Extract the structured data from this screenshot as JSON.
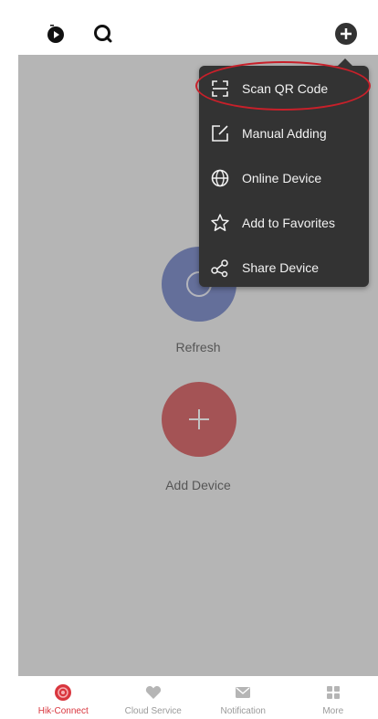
{
  "menu": {
    "items": [
      {
        "label": "Scan QR Code",
        "icon": "scan-qr-icon"
      },
      {
        "label": "Manual Adding",
        "icon": "edit-icon"
      },
      {
        "label": "Online Device",
        "icon": "globe-icon"
      },
      {
        "label": "Add to Favorites",
        "icon": "star-icon"
      },
      {
        "label": "Share Device",
        "icon": "share-icon"
      }
    ]
  },
  "main": {
    "refresh_label": "Refresh",
    "add_device_label": "Add Device"
  },
  "tabbar": {
    "items": [
      {
        "label": "Hik-Connect",
        "active": true
      },
      {
        "label": "Cloud Service",
        "active": false
      },
      {
        "label": "Notification",
        "active": false
      },
      {
        "label": "More",
        "active": false
      }
    ]
  },
  "colors": {
    "accent": "#d9363e",
    "refresh_button": "#5468b7",
    "add_button": "#c8353a",
    "menu_background": "#333333",
    "highlight_ring": "#c8202a"
  }
}
